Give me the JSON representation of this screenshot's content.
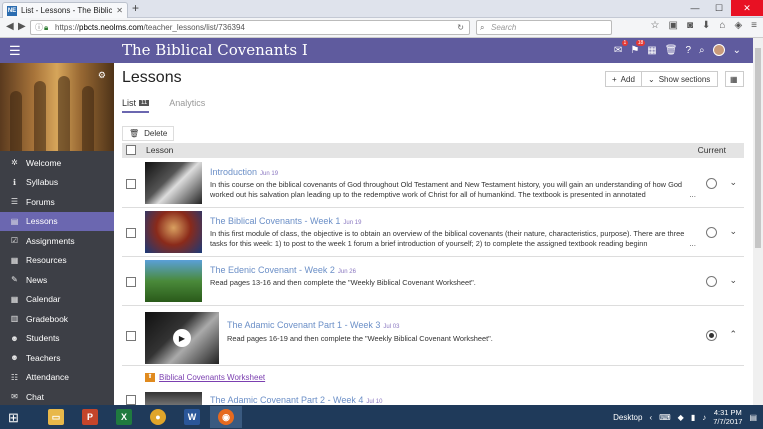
{
  "browser": {
    "tab_title": "List - Lessons - The Biblical C",
    "tab_favicon": "NE",
    "url_prefix": "https://",
    "url_domain": "pbcts.neolms.com",
    "url_path": "/teacher_lessons/list/736394",
    "search_placeholder": "Search"
  },
  "header": {
    "course_title": "The Biblical Covenants I",
    "mail_badge": "1",
    "notif_badge": "18"
  },
  "sidebar": {
    "items": [
      {
        "label": "Welcome",
        "icon": "✲"
      },
      {
        "label": "Syllabus",
        "icon": "ℹ"
      },
      {
        "label": "Forums",
        "icon": "☰"
      },
      {
        "label": "Lessons",
        "icon": "▤",
        "active": true
      },
      {
        "label": "Assignments",
        "icon": "☑"
      },
      {
        "label": "Resources",
        "icon": "▦"
      },
      {
        "label": "News",
        "icon": "✎"
      },
      {
        "label": "Calendar",
        "icon": "▦"
      },
      {
        "label": "Gradebook",
        "icon": "▥"
      },
      {
        "label": "Students",
        "icon": "☻"
      },
      {
        "label": "Teachers",
        "icon": "☻"
      },
      {
        "label": "Attendance",
        "icon": "☷"
      },
      {
        "label": "Chat",
        "icon": "✉"
      }
    ]
  },
  "main": {
    "page_title": "Lessons",
    "add_label": "Add",
    "show_sections_label": "Show sections",
    "tab_list": "List",
    "tab_list_count": "11",
    "tab_analytics": "Analytics",
    "delete_label": "Delete",
    "col_lesson": "Lesson",
    "col_current": "Current",
    "lessons": [
      {
        "title": "Introduction",
        "date": "Jun 19",
        "desc": "In this course on the biblical covenants of God throughout Old Testament and New Testament history, you will gain an understanding of how God worked out his salvation plan leading up to the redemptive work of Christ for all of humankind. The textbook is presented in annotated",
        "ellipsis": "...",
        "current": false
      },
      {
        "title": "The Biblical Covenants - Week 1",
        "date": "Jun 19",
        "desc": "In this first module of class, the objective is to obtain an overview of the biblical covenants (their nature, characteristics, purpose). There are three tasks for this week: 1) to post to the week 1 forum a brief introduction of yourself; 2) to complete the assigned textbook reading beginn",
        "ellipsis": "...",
        "current": false
      },
      {
        "title": "The Edenic Covenant - Week 2",
        "date": "Jun 26",
        "desc": "Read pages 13-16 and then complete the \"Weekly Biblical Covenant Worksheet\".",
        "ellipsis": "",
        "current": false
      },
      {
        "title": "The Adamic Covenant Part 1 - Week 3",
        "date": "Jul 03",
        "desc": "Read pages 16-19 and then complete the \"Weekly Biblical Covenant Worksheet\".",
        "ellipsis": "",
        "current": true
      },
      {
        "title": "The Adamic Covenant Part 2 - Week 4",
        "date": "Jul 10",
        "desc": "",
        "ellipsis": "",
        "current": false
      }
    ],
    "worksheet_link": "Biblical Covenants Worksheet"
  },
  "taskbar": {
    "desktop_label": "Desktop",
    "time": "4:31 PM",
    "date": "7/7/2017"
  },
  "colors": {
    "header_purple": "#5f5b9e",
    "active_nav": "#6b67b0",
    "sidebar_bg": "#3d3f46",
    "link_blue": "#6b8fc7",
    "taskbar": "#1f3a5a"
  }
}
